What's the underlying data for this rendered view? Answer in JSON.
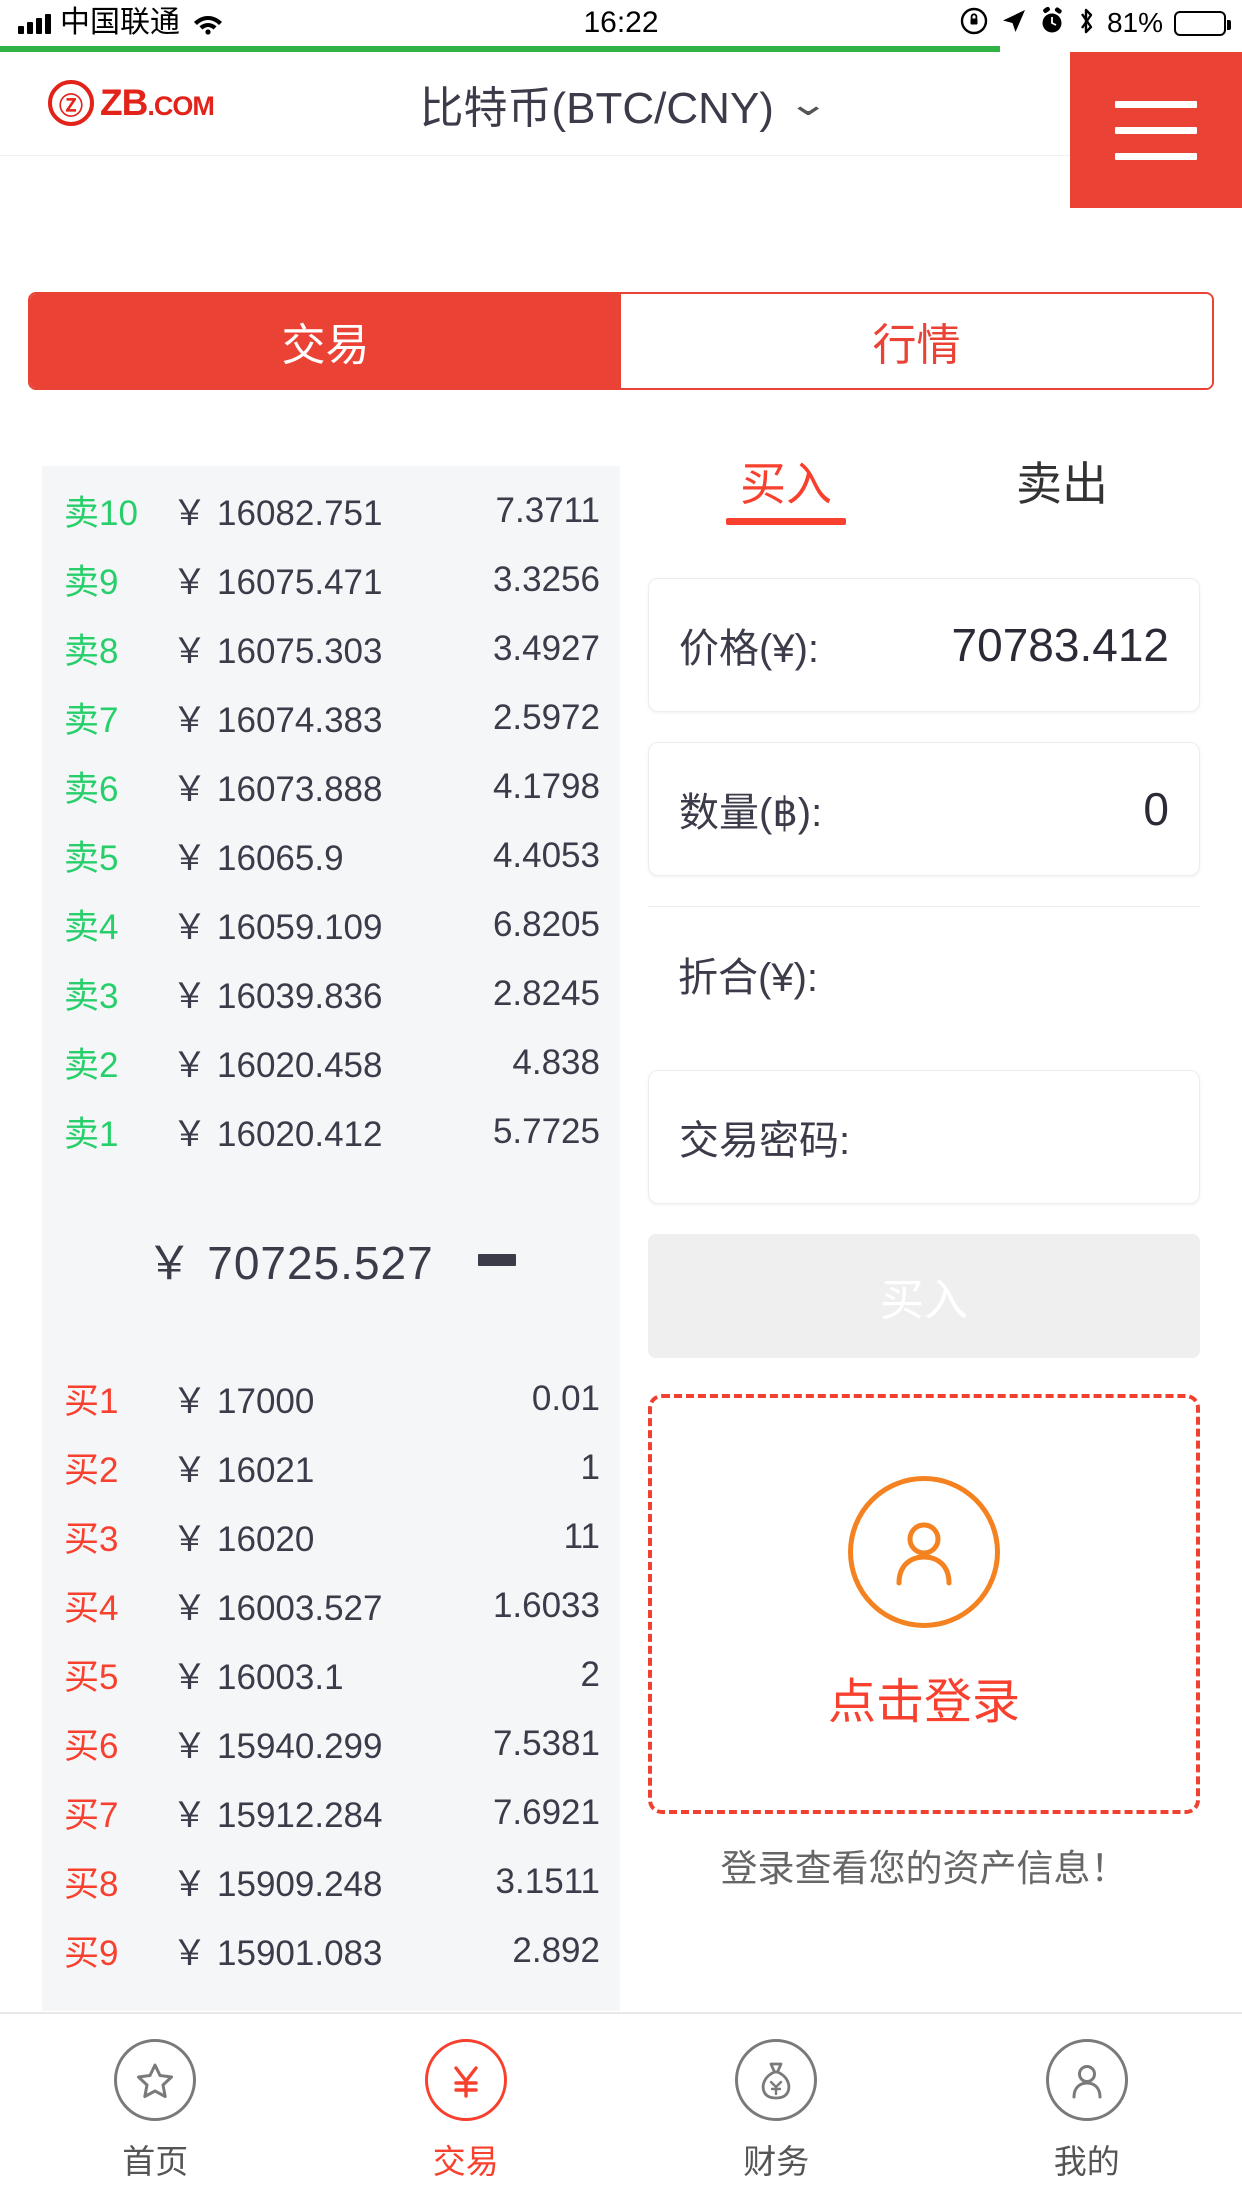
{
  "status_bar": {
    "carrier": "中国联通",
    "time": "16:22",
    "battery_percent": "81%",
    "icons": [
      "signal-bars-icon",
      "wifi-icon",
      "rotation-lock-icon",
      "location-arrow-icon",
      "alarm-clock-icon",
      "bluetooth-icon",
      "battery-icon"
    ]
  },
  "header": {
    "logo_text": "ZB",
    "logo_suffix": ".COM",
    "logo_mark": "Ⓩ",
    "title": "比特币(BTC/CNY)",
    "chevron": "⌄",
    "menu_icon": "hamburger-menu-icon"
  },
  "tabs": [
    {
      "label": "交易",
      "active": true
    },
    {
      "label": "行情",
      "active": false
    }
  ],
  "order_book": {
    "currency_symbol": "￥",
    "sell_orders": [
      {
        "label": "卖",
        "index": "10",
        "price": "16082.751",
        "amount": "7.3711"
      },
      {
        "label": "卖",
        "index": "9",
        "price": "16075.471",
        "amount": "3.3256"
      },
      {
        "label": "卖",
        "index": "8",
        "price": "16075.303",
        "amount": "3.4927"
      },
      {
        "label": "卖",
        "index": "7",
        "price": "16074.383",
        "amount": "2.5972"
      },
      {
        "label": "卖",
        "index": "6",
        "price": "16073.888",
        "amount": "4.1798"
      },
      {
        "label": "卖",
        "index": "5",
        "price": "16065.9",
        "amount": "4.4053"
      },
      {
        "label": "卖",
        "index": "4",
        "price": "16059.109",
        "amount": "6.8205"
      },
      {
        "label": "卖",
        "index": "3",
        "price": "16039.836",
        "amount": "2.8245"
      },
      {
        "label": "卖",
        "index": "2",
        "price": "16020.458",
        "amount": "4.838"
      },
      {
        "label": "卖",
        "index": "1",
        "price": "16020.412",
        "amount": "5.7725"
      }
    ],
    "last_price": "70725.527",
    "last_price_trend": "flat",
    "buy_orders": [
      {
        "label": "买",
        "index": "1",
        "price": "17000",
        "amount": "0.01"
      },
      {
        "label": "买",
        "index": "2",
        "price": "16021",
        "amount": "1"
      },
      {
        "label": "买",
        "index": "3",
        "price": "16020",
        "amount": "11"
      },
      {
        "label": "买",
        "index": "4",
        "price": "16003.527",
        "amount": "1.6033"
      },
      {
        "label": "买",
        "index": "5",
        "price": "16003.1",
        "amount": "2"
      },
      {
        "label": "买",
        "index": "6",
        "price": "15940.299",
        "amount": "7.5381"
      },
      {
        "label": "买",
        "index": "7",
        "price": "15912.284",
        "amount": "7.6921"
      },
      {
        "label": "买",
        "index": "8",
        "price": "15909.248",
        "amount": "3.1511"
      },
      {
        "label": "买",
        "index": "9",
        "price": "15901.083",
        "amount": "2.892"
      }
    ]
  },
  "trade_panel": {
    "tabs": [
      {
        "label": "买入",
        "active": true
      },
      {
        "label": "卖出",
        "active": false
      }
    ],
    "fields": [
      {
        "label": "价格(¥):",
        "value": "70783.412"
      },
      {
        "label": "数量(฿):",
        "value": "0"
      },
      {
        "label": "折合(¥):",
        "value": ""
      },
      {
        "label": "交易密码:",
        "value": ""
      }
    ],
    "submit_label": "买入",
    "login_prompt": {
      "avatar_icon": "person-icon",
      "text": "点击登录",
      "subtext": "登录查看您的资产信息！"
    }
  },
  "bottom_nav": [
    {
      "label": "首页",
      "icon": "star-icon",
      "active": false
    },
    {
      "label": "交易",
      "icon": "exchange-icon",
      "active": true
    },
    {
      "label": "财务",
      "icon": "moneybag-icon",
      "active": false
    },
    {
      "label": "我的",
      "icon": "person-icon",
      "active": false
    }
  ],
  "colors": {
    "brand_red": "#ea4335",
    "buy_red": "#f8402f",
    "sell_green": "#27cf6a",
    "accent_orange": "#f58220",
    "book_bg": "#f5f6f8"
  }
}
